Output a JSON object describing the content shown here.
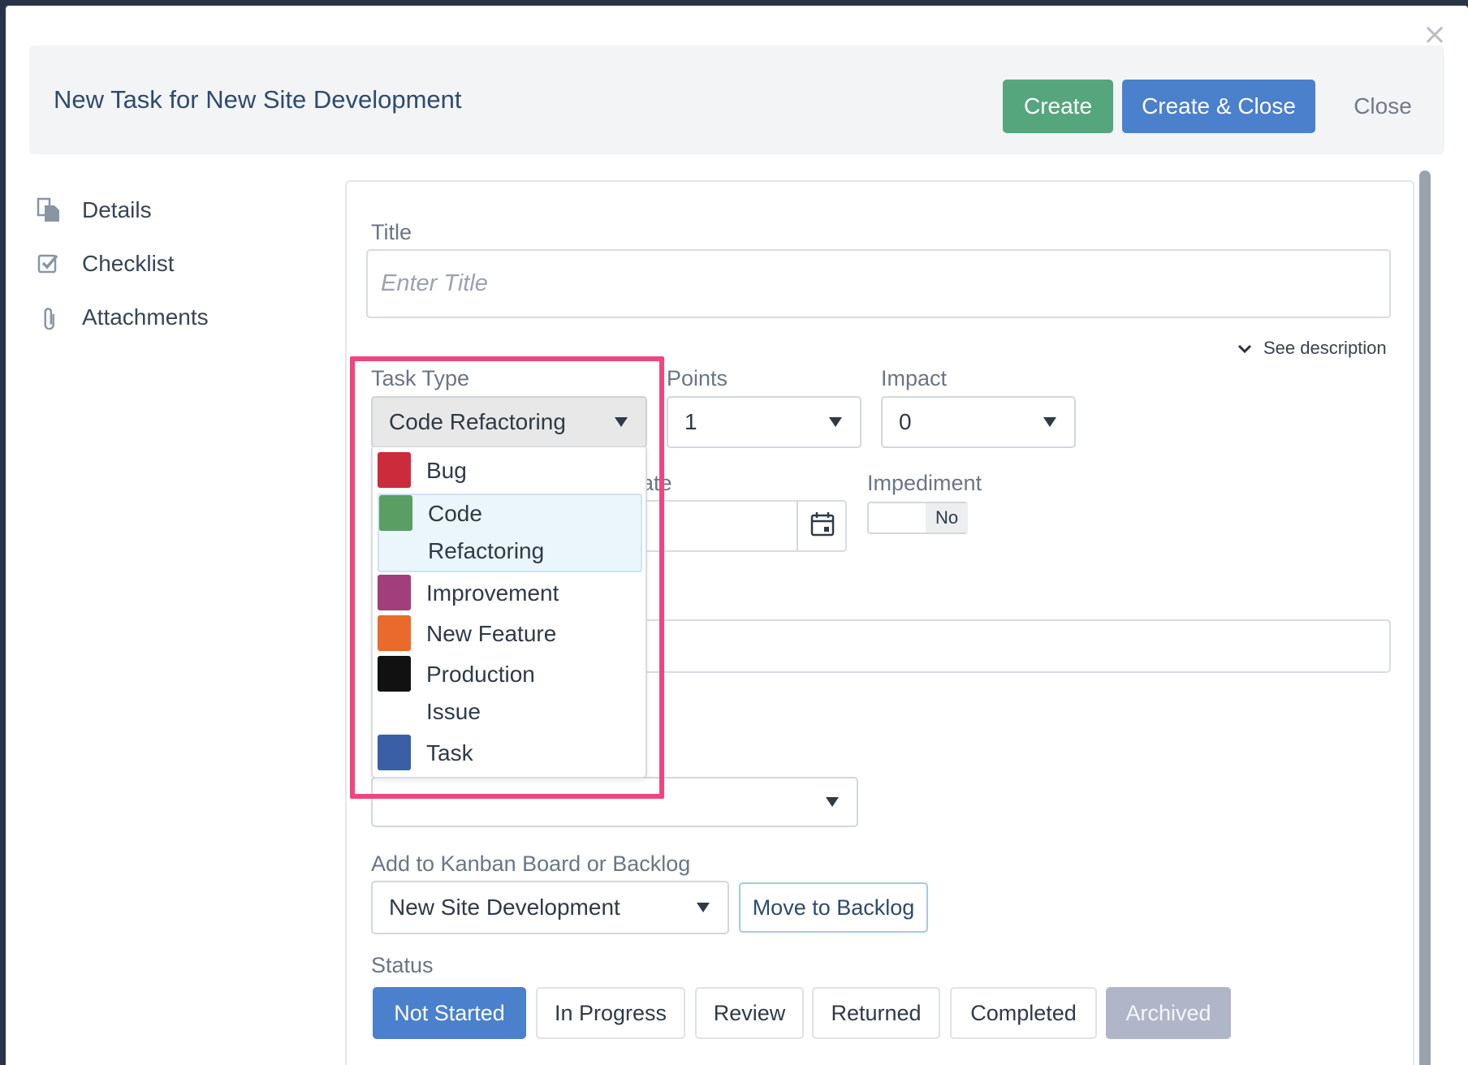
{
  "modal": {
    "title": "New Task for New Site Development",
    "buttons": {
      "create": "Create",
      "create_close": "Create & Close",
      "close": "Close"
    }
  },
  "sidenav": {
    "items": [
      {
        "label": "Details",
        "icon": "documents-icon"
      },
      {
        "label": "Checklist",
        "icon": "checkbox-icon"
      },
      {
        "label": "Attachments",
        "icon": "paperclip-icon"
      }
    ]
  },
  "form": {
    "title_label": "Title",
    "title_placeholder": "Enter Title",
    "see_description": "See description",
    "task_type": {
      "label": "Task Type",
      "value": "Code Refactoring",
      "options": [
        {
          "label": "Bug",
          "color": "#cc2b3b"
        },
        {
          "label": "Code Refactoring",
          "color": "#5a9e63",
          "selected": true
        },
        {
          "label": "Improvement",
          "color": "#a23f7a"
        },
        {
          "label": "New Feature",
          "color": "#e86a2c"
        },
        {
          "label": "Production Issue",
          "color": "#111111"
        },
        {
          "label": "Task",
          "color": "#3a5fa6"
        }
      ]
    },
    "points": {
      "label": "Points",
      "value": "1"
    },
    "impact": {
      "label": "Impact",
      "value": "0"
    },
    "date_label_partial": "ate",
    "impediment": {
      "label": "Impediment",
      "value": "No"
    },
    "kanban": {
      "label": "Add to Kanban Board or Backlog",
      "value": "New Site Development",
      "move_button": "Move to Backlog"
    },
    "status": {
      "label": "Status",
      "options": [
        "Not Started",
        "In Progress",
        "Review",
        "Returned",
        "Completed",
        "Archived"
      ],
      "active": "Not Started"
    }
  }
}
